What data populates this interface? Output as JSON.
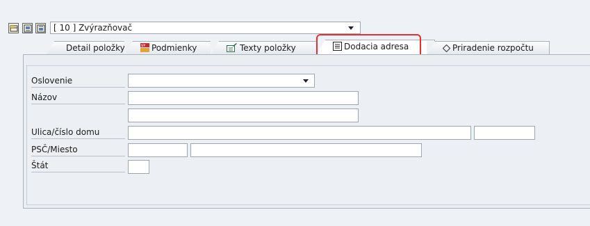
{
  "toolbar": {
    "icons": [
      "collapse-icon",
      "previous-item-icon",
      "next-item-icon"
    ],
    "item_select": {
      "value": "[ 10 ] Zvýrazňovač"
    }
  },
  "tabs": [
    {
      "label": "Detail položky",
      "icon": ""
    },
    {
      "label": "Podmienky",
      "icon": "conditions-icon"
    },
    {
      "label": "Texty položky",
      "icon": "texts-icon"
    },
    {
      "label": "Dodacia adresa",
      "icon": "address-icon",
      "active": true
    },
    {
      "label": "Priradenie rozpočtu",
      "icon": "diamond-icon"
    }
  ],
  "form": {
    "salutation_label": "Oslovenie",
    "name_label": "Názov",
    "street_label": "Ulica/číslo domu",
    "postal_label": "PSČ/Miesto",
    "country_label": "Štát",
    "values": {
      "salutation": "",
      "name1": "",
      "name2": "",
      "street": "",
      "house_no": "",
      "postal_code": "",
      "city": "",
      "country": ""
    }
  },
  "colors": {
    "highlight": "#e53030",
    "panel_bg": "#eaedf2"
  }
}
